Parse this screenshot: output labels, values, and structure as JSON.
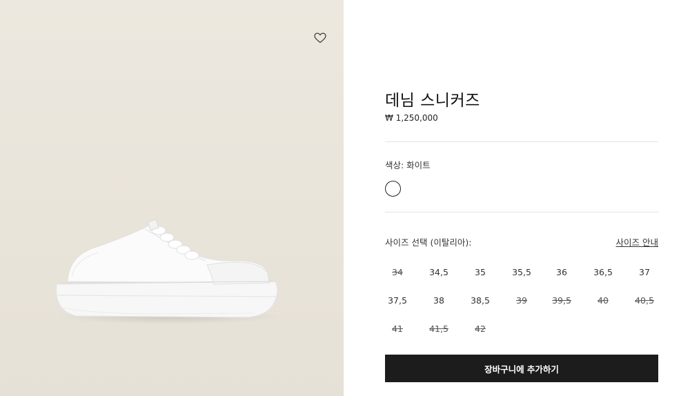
{
  "product": {
    "title": "데님 스니커즈",
    "price": "₩ 1,250,000"
  },
  "color": {
    "label": "색상:  화이트",
    "selected_swatch": "#ffffff"
  },
  "sizes": {
    "label": "사이즈 선택 (이탈리아):",
    "guide_link": "사이즈 안내",
    "options": [
      {
        "value": "34",
        "available": false
      },
      {
        "value": "34,5",
        "available": true
      },
      {
        "value": "35",
        "available": true
      },
      {
        "value": "35,5",
        "available": true
      },
      {
        "value": "36",
        "available": true
      },
      {
        "value": "36,5",
        "available": true
      },
      {
        "value": "37",
        "available": true
      },
      {
        "value": "37,5",
        "available": true
      },
      {
        "value": "38",
        "available": true
      },
      {
        "value": "38,5",
        "available": true
      },
      {
        "value": "39",
        "available": false
      },
      {
        "value": "39,5",
        "available": false
      },
      {
        "value": "40",
        "available": false
      },
      {
        "value": "40,5",
        "available": false
      },
      {
        "value": "41",
        "available": false
      },
      {
        "value": "41,5",
        "available": false
      },
      {
        "value": "42",
        "available": false
      }
    ]
  },
  "cart": {
    "button_label": "장바구니에 추가하기"
  },
  "icons": {
    "wishlist": "heart-icon"
  }
}
